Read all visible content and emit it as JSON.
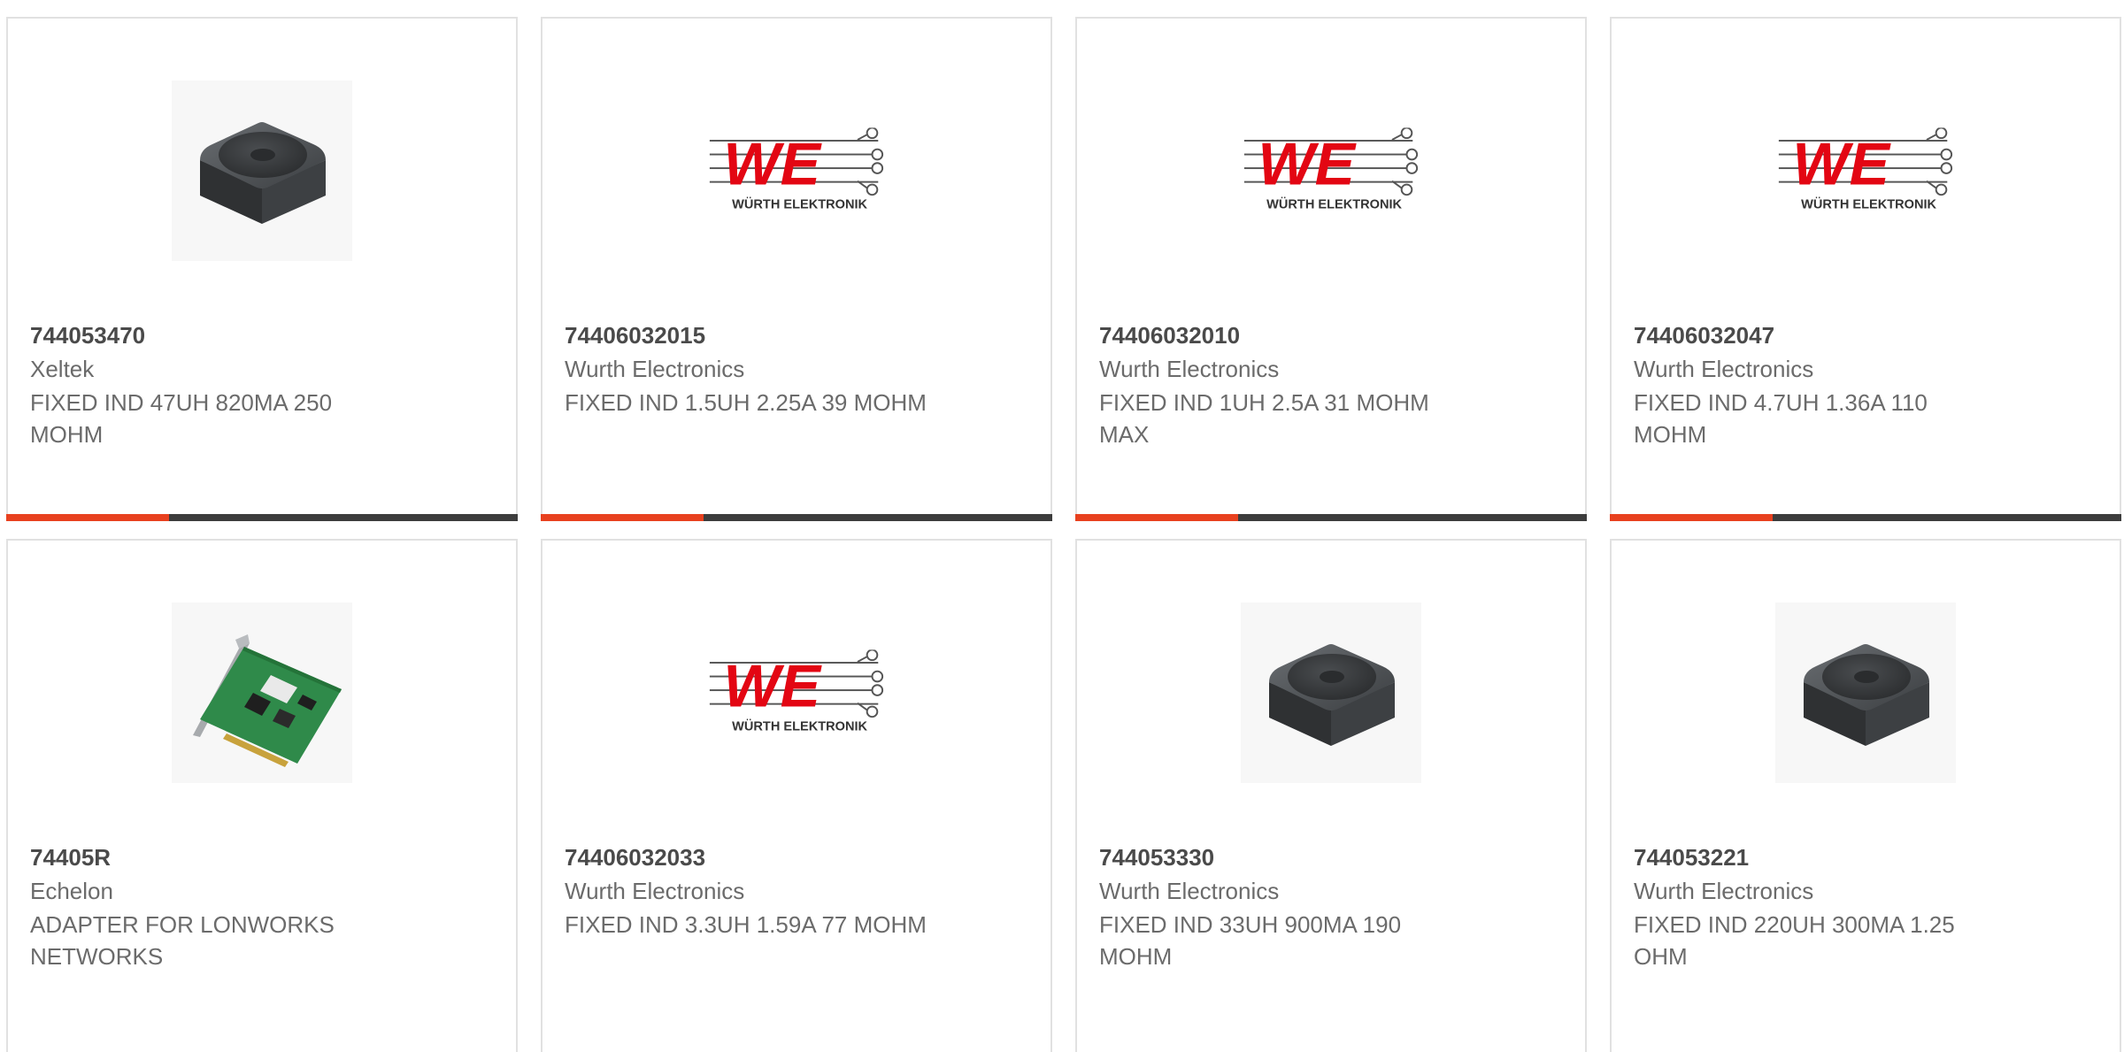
{
  "products": [
    {
      "part_number": "744053470",
      "manufacturer": "Xeltek",
      "description": "FIXED IND 47UH 820MA 250 MOHM",
      "image": "inductor-photo",
      "highlighted": true
    },
    {
      "part_number": "74406032015",
      "manufacturer": "Wurth Electronics",
      "description": "FIXED IND 1.5UH 2.25A 39 MOHM",
      "image": "wurth-logo",
      "highlighted": true
    },
    {
      "part_number": "74406032010",
      "manufacturer": "Wurth Electronics",
      "description": "FIXED IND 1UH 2.5A 31 MOHM MAX",
      "image": "wurth-logo",
      "highlighted": true
    },
    {
      "part_number": "74406032047",
      "manufacturer": "Wurth Electronics",
      "description": "FIXED IND 4.7UH 1.36A 110 MOHM",
      "image": "wurth-logo",
      "highlighted": true
    },
    {
      "part_number": "74405R",
      "manufacturer": "Echelon",
      "description": "ADAPTER FOR LONWORKS NETWORKS",
      "image": "pci-card-photo",
      "highlighted": false
    },
    {
      "part_number": "74406032033",
      "manufacturer": "Wurth Electronics",
      "description": "FIXED IND 3.3UH 1.59A 77 MOHM",
      "image": "wurth-logo",
      "highlighted": false
    },
    {
      "part_number": "744053330",
      "manufacturer": "Wurth Electronics",
      "description": "FIXED IND 33UH 900MA 190 MOHM",
      "image": "inductor-photo",
      "highlighted": false
    },
    {
      "part_number": "744053221",
      "manufacturer": "Wurth Electronics",
      "description": "FIXED IND 220UH 300MA 1.25 OHM",
      "image": "inductor-photo",
      "highlighted": false
    }
  ],
  "logo": {
    "brand_mark": "WE",
    "brand_name": "WÜRTH ELEKTRONIK"
  },
  "colors": {
    "accent": "#e8411f",
    "bar_dark": "#3d3d3d",
    "logo_red": "#e30613",
    "card_border": "#e1e1e1"
  }
}
